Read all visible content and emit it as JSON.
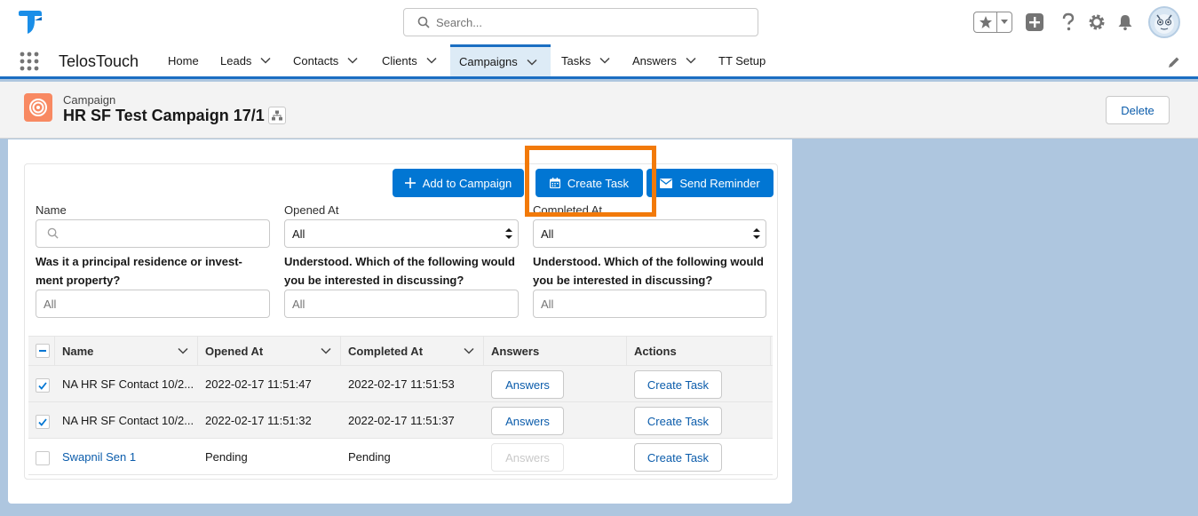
{
  "header": {
    "search_placeholder": "Search..."
  },
  "nav": {
    "app_name": "TelosTouch",
    "items": [
      {
        "label": "Home"
      },
      {
        "label": "Leads"
      },
      {
        "label": "Contacts"
      },
      {
        "label": "Clients"
      },
      {
        "label": "Campaigns"
      },
      {
        "label": "Tasks"
      },
      {
        "label": "Answers"
      },
      {
        "label": "TT Setup"
      }
    ],
    "active": "Campaigns"
  },
  "record": {
    "type": "Campaign",
    "title": "HR SF Test Campaign 17/1",
    "delete_label": "Delete"
  },
  "actions": {
    "add_to_campaign": "Add to Campaign",
    "create_task": "Create Task",
    "send_reminder": "Send Reminder"
  },
  "filters": {
    "name_label": "Name",
    "opened_label": "Opened At",
    "opened_value": "All",
    "completed_label": "Completed At",
    "completed_value": "All",
    "q1_label": "Was it a principal residence or invest-ment property?",
    "q1_placeholder": "All",
    "q2_label": "Understood. Which of the following would you be interested in discussing?",
    "q2_placeholder": "All",
    "q3_label": "Understood. Which of the following would you be interested in discussing?",
    "q3_placeholder": "All"
  },
  "table": {
    "columns": [
      "Name",
      "Opened At",
      "Completed At",
      "Answers",
      "Actions"
    ],
    "rows": [
      {
        "name": "NA HR SF Contact 10/2...",
        "opened": "2022-02-17 11:51:47",
        "completed": "2022-02-17 11:51:53",
        "answers": "Answers",
        "action": "Create Task",
        "checked": true,
        "answers_enabled": true
      },
      {
        "name": "NA HR SF Contact 10/2...",
        "opened": "2022-02-17 11:51:32",
        "completed": "2022-02-17 11:51:37",
        "answers": "Answers",
        "action": "Create Task",
        "checked": true,
        "answers_enabled": true
      },
      {
        "name": "Swapnil Sen 1",
        "opened": "Pending",
        "completed": "Pending",
        "answers": "Answers",
        "action": "Create Task",
        "checked": false,
        "answers_enabled": false
      }
    ]
  },
  "colors": {
    "brand": "#0176d3",
    "highlight": "#f27a0a",
    "campaign_icon": "#f88962",
    "link": "#0b5cab"
  }
}
